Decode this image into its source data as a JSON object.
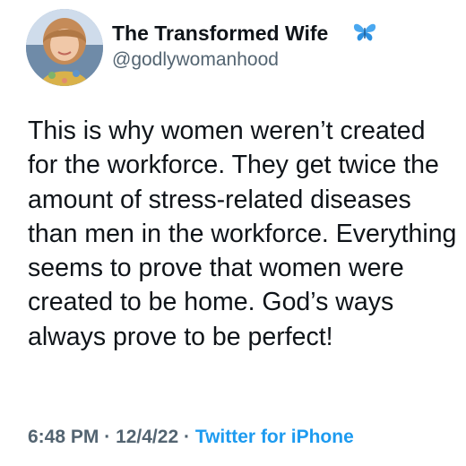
{
  "author": {
    "name": "The Transformed Wife",
    "handle": "@godlywomanhood",
    "name_emoji": "butterfly-icon"
  },
  "tweet": {
    "lines": [
      "This is why women weren’t created",
      "for the workforce. They get twice the",
      "amount of stress-related diseases",
      "than men in the workforce. Everything",
      "seems to prove that women were",
      "created to be home. God’s ways",
      "always prove to be perfect!"
    ]
  },
  "meta": {
    "time": "6:48 PM",
    "separator": "·",
    "date": "12/4/22",
    "source": "Twitter for iPhone"
  },
  "colors": {
    "text": "#0f1419",
    "secondary": "#536471",
    "link": "#1d9bf0",
    "butterfly": "#4aa8f0"
  }
}
